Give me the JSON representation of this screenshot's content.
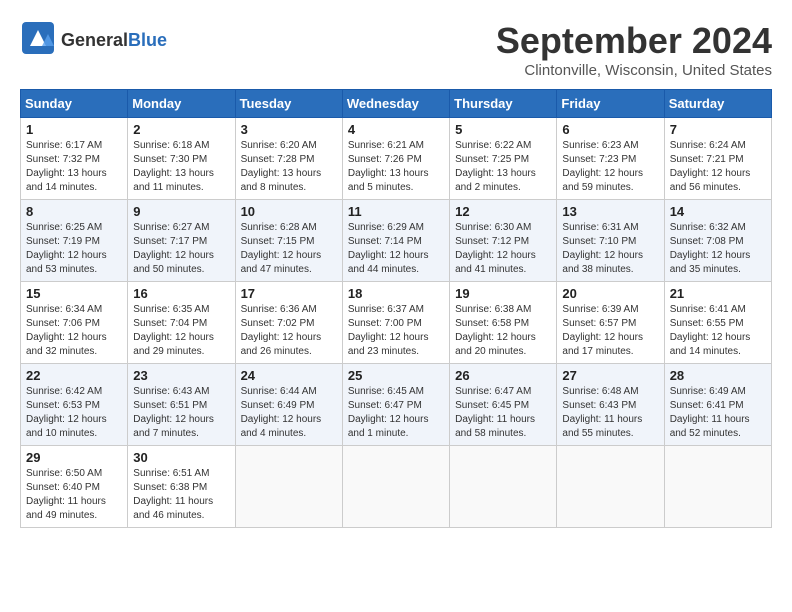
{
  "header": {
    "logo_general": "General",
    "logo_blue": "Blue",
    "month_title": "September 2024",
    "location": "Clintonville, Wisconsin, United States"
  },
  "days_of_week": [
    "Sunday",
    "Monday",
    "Tuesday",
    "Wednesday",
    "Thursday",
    "Friday",
    "Saturday"
  ],
  "weeks": [
    [
      {
        "day": "1",
        "info": "Sunrise: 6:17 AM\nSunset: 7:32 PM\nDaylight: 13 hours\nand 14 minutes."
      },
      {
        "day": "2",
        "info": "Sunrise: 6:18 AM\nSunset: 7:30 PM\nDaylight: 13 hours\nand 11 minutes."
      },
      {
        "day": "3",
        "info": "Sunrise: 6:20 AM\nSunset: 7:28 PM\nDaylight: 13 hours\nand 8 minutes."
      },
      {
        "day": "4",
        "info": "Sunrise: 6:21 AM\nSunset: 7:26 PM\nDaylight: 13 hours\nand 5 minutes."
      },
      {
        "day": "5",
        "info": "Sunrise: 6:22 AM\nSunset: 7:25 PM\nDaylight: 13 hours\nand 2 minutes."
      },
      {
        "day": "6",
        "info": "Sunrise: 6:23 AM\nSunset: 7:23 PM\nDaylight: 12 hours\nand 59 minutes."
      },
      {
        "day": "7",
        "info": "Sunrise: 6:24 AM\nSunset: 7:21 PM\nDaylight: 12 hours\nand 56 minutes."
      }
    ],
    [
      {
        "day": "8",
        "info": "Sunrise: 6:25 AM\nSunset: 7:19 PM\nDaylight: 12 hours\nand 53 minutes."
      },
      {
        "day": "9",
        "info": "Sunrise: 6:27 AM\nSunset: 7:17 PM\nDaylight: 12 hours\nand 50 minutes."
      },
      {
        "day": "10",
        "info": "Sunrise: 6:28 AM\nSunset: 7:15 PM\nDaylight: 12 hours\nand 47 minutes."
      },
      {
        "day": "11",
        "info": "Sunrise: 6:29 AM\nSunset: 7:14 PM\nDaylight: 12 hours\nand 44 minutes."
      },
      {
        "day": "12",
        "info": "Sunrise: 6:30 AM\nSunset: 7:12 PM\nDaylight: 12 hours\nand 41 minutes."
      },
      {
        "day": "13",
        "info": "Sunrise: 6:31 AM\nSunset: 7:10 PM\nDaylight: 12 hours\nand 38 minutes."
      },
      {
        "day": "14",
        "info": "Sunrise: 6:32 AM\nSunset: 7:08 PM\nDaylight: 12 hours\nand 35 minutes."
      }
    ],
    [
      {
        "day": "15",
        "info": "Sunrise: 6:34 AM\nSunset: 7:06 PM\nDaylight: 12 hours\nand 32 minutes."
      },
      {
        "day": "16",
        "info": "Sunrise: 6:35 AM\nSunset: 7:04 PM\nDaylight: 12 hours\nand 29 minutes."
      },
      {
        "day": "17",
        "info": "Sunrise: 6:36 AM\nSunset: 7:02 PM\nDaylight: 12 hours\nand 26 minutes."
      },
      {
        "day": "18",
        "info": "Sunrise: 6:37 AM\nSunset: 7:00 PM\nDaylight: 12 hours\nand 23 minutes."
      },
      {
        "day": "19",
        "info": "Sunrise: 6:38 AM\nSunset: 6:58 PM\nDaylight: 12 hours\nand 20 minutes."
      },
      {
        "day": "20",
        "info": "Sunrise: 6:39 AM\nSunset: 6:57 PM\nDaylight: 12 hours\nand 17 minutes."
      },
      {
        "day": "21",
        "info": "Sunrise: 6:41 AM\nSunset: 6:55 PM\nDaylight: 12 hours\nand 14 minutes."
      }
    ],
    [
      {
        "day": "22",
        "info": "Sunrise: 6:42 AM\nSunset: 6:53 PM\nDaylight: 12 hours\nand 10 minutes."
      },
      {
        "day": "23",
        "info": "Sunrise: 6:43 AM\nSunset: 6:51 PM\nDaylight: 12 hours\nand 7 minutes."
      },
      {
        "day": "24",
        "info": "Sunrise: 6:44 AM\nSunset: 6:49 PM\nDaylight: 12 hours\nand 4 minutes."
      },
      {
        "day": "25",
        "info": "Sunrise: 6:45 AM\nSunset: 6:47 PM\nDaylight: 12 hours\nand 1 minute."
      },
      {
        "day": "26",
        "info": "Sunrise: 6:47 AM\nSunset: 6:45 PM\nDaylight: 11 hours\nand 58 minutes."
      },
      {
        "day": "27",
        "info": "Sunrise: 6:48 AM\nSunset: 6:43 PM\nDaylight: 11 hours\nand 55 minutes."
      },
      {
        "day": "28",
        "info": "Sunrise: 6:49 AM\nSunset: 6:41 PM\nDaylight: 11 hours\nand 52 minutes."
      }
    ],
    [
      {
        "day": "29",
        "info": "Sunrise: 6:50 AM\nSunset: 6:40 PM\nDaylight: 11 hours\nand 49 minutes."
      },
      {
        "day": "30",
        "info": "Sunrise: 6:51 AM\nSunset: 6:38 PM\nDaylight: 11 hours\nand 46 minutes."
      },
      {
        "day": "",
        "info": ""
      },
      {
        "day": "",
        "info": ""
      },
      {
        "day": "",
        "info": ""
      },
      {
        "day": "",
        "info": ""
      },
      {
        "day": "",
        "info": ""
      }
    ]
  ]
}
